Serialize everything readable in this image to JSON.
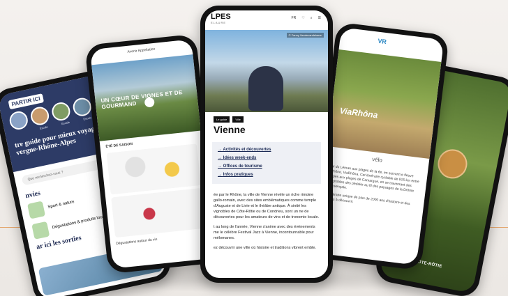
{
  "phone1": {
    "logo": "PARTIR ICI",
    "heading": "tre guide pour mieux voyager en vergne-Rhône-Alpes",
    "circle_labels": [
      "",
      "Escale",
      "Escale",
      "Escale"
    ],
    "search_placeholder": "Que recherchez-vous ?",
    "section": "nvies",
    "tiles": [
      "Sport & nature",
      "Dégustations & produits locaux"
    ],
    "section2": "ar ici les sorties"
  },
  "phone2": {
    "brand": "Avenir Appellation",
    "hero_title": "UN CŒUR DE VIGNES ET DE GOURMAND",
    "band": "ÉTÉ DE SAISON",
    "caption": "Dégustations autour du vin"
  },
  "phone3": {
    "brand": "LPES",
    "brand_sub": "ELAURE",
    "nav_lang": "FR",
    "photo_credit": "© Fanny Vandecandelaere",
    "tags": [
      "Le guide",
      "Ville"
    ],
    "title": "Vienne",
    "menu": [
      "Activités et découvertes",
      "Idées week-ends",
      "Offices de tourisme",
      "Infos pratiques"
    ],
    "body": [
      "ée par le Rhône, la ville de Vienne révèle un riche rimoine gallo-romain, avec des sites emblématiques comme temple d'Auguste et de Livie et le théâtre antique. À sinité les vignobles de Côte-Rôtie ou de Condrieu, sont un ne de découvertes pour les amateurs de vins et de tronomie locale.",
      "t au long de l'année, Vienne s'anime avec des événements me le célèbre Festival Jazz à Vienne, incontournable pour mélomanes.",
      "ez découvrir une ville où histoire et traditions vibrent emble."
    ]
  },
  "phone4": {
    "logo": "VR",
    "hero_title": "ViaRhôna",
    "subtitle": "vélo",
    "text": [
      "ar du Léman aux plages de la ée, en suivant le fleuve Rhône, ViaRhôna. Cet itinéraire cyclable de 815 km entre alpes aux plages de Camargue, en se traversant des vignobles des pédaler au fil des paysages de la Drôme provençale.",
      "itinéraire unique de plus de 2000 ans d'histoire et des sites à découvrir."
    ]
  },
  "phone5": {
    "label": "CONDRIEU CÔTE-RÔTIE"
  }
}
